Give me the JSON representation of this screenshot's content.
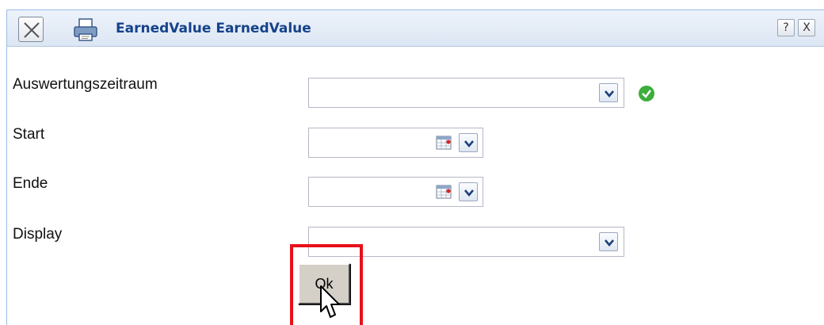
{
  "window": {
    "title": "EarnedValue EarnedValue",
    "help_label": "?",
    "close_label": "X"
  },
  "form": {
    "fields": [
      {
        "label": "Auswertungszeitraum",
        "value": "",
        "type": "combo"
      },
      {
        "label": "Start",
        "value": "",
        "type": "date"
      },
      {
        "label": "Ende",
        "value": "",
        "type": "date"
      },
      {
        "label": "Display",
        "value": "",
        "type": "combo"
      }
    ],
    "ok_label": "Ok"
  },
  "icons": {
    "close": "close-icon",
    "print": "printer-icon",
    "valid": "check-circle-icon",
    "calendar": "calendar-icon",
    "dropdown": "chevron-down-icon",
    "cursor": "mouse-pointer-icon"
  },
  "colors": {
    "title": "#15428b",
    "highlight": "#e8101a",
    "valid": "#3cae3c"
  }
}
